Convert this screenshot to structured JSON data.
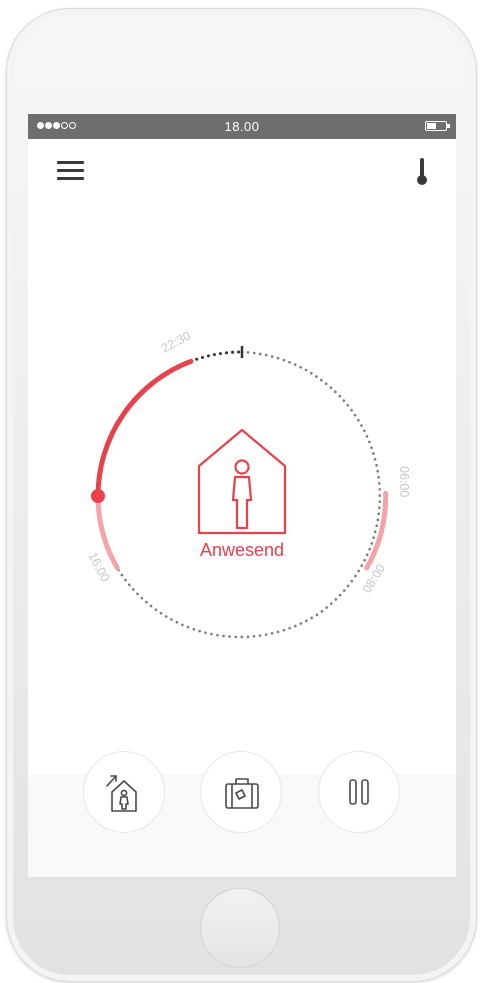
{
  "status_bar": {
    "time": "18.00",
    "signal_bars_filled": 3,
    "signal_bars_total": 5,
    "battery_level": 0.5
  },
  "header": {
    "menu_icon": "hamburger-menu-icon",
    "thermometer_icon": "thermometer-icon"
  },
  "schedule": {
    "time_labels": [
      "22:30",
      "06:00",
      "08:00",
      "16:00"
    ],
    "status": "Anwesend",
    "status_icon": "home-person-icon"
  },
  "controls": [
    {
      "name": "home-mode",
      "icon": "home-arrow-icon"
    },
    {
      "name": "away-mode",
      "icon": "suitcase-icon"
    },
    {
      "name": "pause",
      "icon": "pause-icon"
    }
  ],
  "colors": {
    "accent": "#e8414b",
    "accent_light": "#f5a3a8",
    "status_bar": "#6e6e6e",
    "dotted_track": "#7a7a7a"
  }
}
